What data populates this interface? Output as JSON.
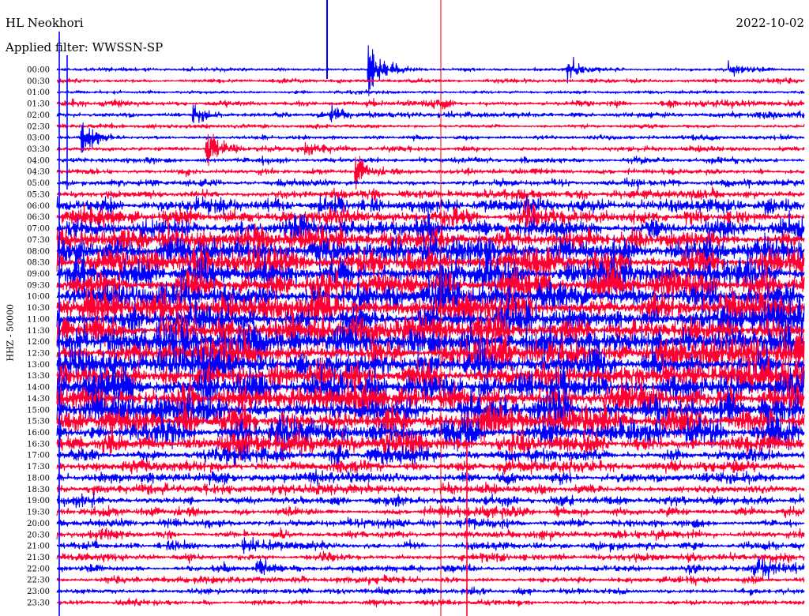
{
  "header": {
    "station": "HL Neokhori",
    "filter": "Applied filter: WWSSN-SP",
    "date": "2022-10-02"
  },
  "chart_data": {
    "type": "line",
    "title": "HL Neokhori",
    "subtitle": "Applied filter: WWSSN-SP",
    "date": "2022-10-02",
    "ylabel": "HHZ - 50000",
    "y_tick_labels": [
      "00:00",
      "00:30",
      "01:00",
      "01:30",
      "02:00",
      "02:30",
      "03:00",
      "03:30",
      "04:00",
      "04:30",
      "05:00",
      "05:30",
      "06:00",
      "06:30",
      "07:00",
      "07:30",
      "08:00",
      "08:30",
      "09:00",
      "09:30",
      "10:00",
      "10:30",
      "11:00",
      "11:30",
      "12:00",
      "12:30",
      "13:00",
      "13:30",
      "14:00",
      "14:30",
      "15:00",
      "15:30",
      "16:00",
      "16:30",
      "17:00",
      "17:30",
      "18:00",
      "18:30",
      "19:00",
      "19:30",
      "20:00",
      "20:30",
      "21:00",
      "21:30",
      "22:00",
      "22:30",
      "23:00",
      "23:30"
    ],
    "trace_colors": [
      "#0000ff",
      "#ff0033"
    ],
    "marker_color": "#ff0000",
    "activity_by_row": [
      0.2,
      0.25,
      0.2,
      0.6,
      0.45,
      0.3,
      0.3,
      0.35,
      0.45,
      0.5,
      0.55,
      1.0,
      1.3,
      1.8,
      2.2,
      2.4,
      2.6,
      2.8,
      2.9,
      3.0,
      3.0,
      3.0,
      3.0,
      3.0,
      3.0,
      3.0,
      3.0,
      3.0,
      3.0,
      3.0,
      2.9,
      2.8,
      2.6,
      2.2,
      1.5,
      1.2,
      1.0,
      0.9,
      0.85,
      0.8,
      0.75,
      0.7,
      0.7,
      0.65,
      0.6,
      0.55,
      0.5,
      0.45
    ],
    "events": [
      {
        "time": "00:00",
        "minute": 12.5,
        "strength": 4.0
      },
      {
        "time": "00:00",
        "minute": 20.5,
        "strength": 1.6
      },
      {
        "time": "00:00",
        "minute": 27.0,
        "strength": 0.8
      },
      {
        "time": "02:00",
        "minute": 5.5,
        "strength": 1.2
      },
      {
        "time": "02:00",
        "minute": 11.0,
        "strength": 1.0
      },
      {
        "time": "03:00",
        "minute": 1.0,
        "strength": 2.5
      },
      {
        "time": "03:30",
        "minute": 6.0,
        "strength": 3.0
      },
      {
        "time": "03:30",
        "minute": 10.0,
        "strength": 1.0
      },
      {
        "time": "04:30",
        "minute": 12.0,
        "strength": 2.0
      },
      {
        "time": "21:00",
        "minute": 7.5,
        "strength": 1.0
      },
      {
        "time": "22:00",
        "minute": 28.0,
        "strength": 1.3
      },
      {
        "time": "22:00",
        "minute": 8.0,
        "strength": 1.2
      }
    ]
  }
}
